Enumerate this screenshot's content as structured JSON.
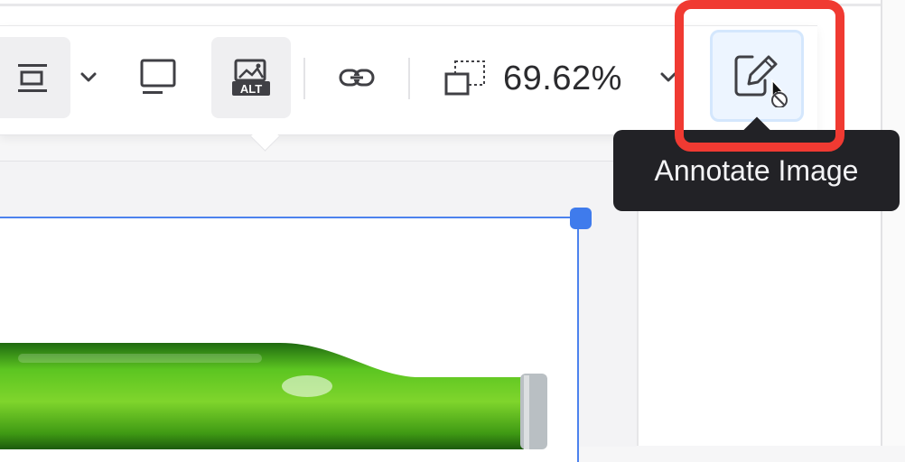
{
  "toolbar": {
    "buttons": {
      "align": "align-center-icon",
      "align_dropdown": "chevron-down-icon",
      "display_mode": "desktop-icon",
      "alt_text": "alt-text-icon",
      "alt_badge": "ALT",
      "link": "link-icon",
      "resize": "resize-icon",
      "zoom_dropdown": "chevron-down-icon",
      "annotate": "annotate-icon"
    },
    "zoom_value": "69.62%"
  },
  "tooltip": {
    "text": "Annotate Image"
  },
  "colors": {
    "accent_blue": "#3f7bec",
    "highlight_red": "#f03a32",
    "tooltip_bg": "#222226",
    "bottle_green": "#4fb41a"
  }
}
